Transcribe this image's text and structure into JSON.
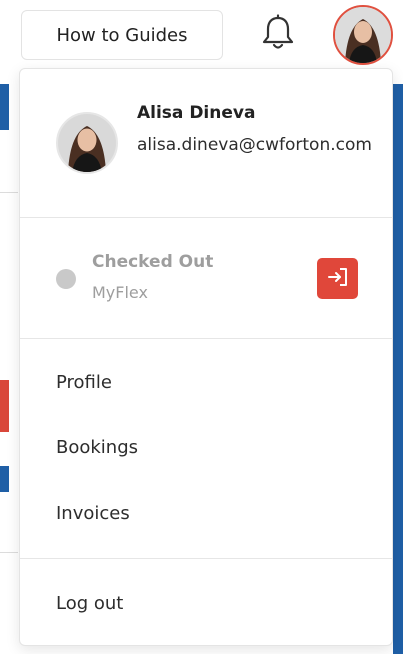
{
  "header": {
    "guides_label": "How to Guides",
    "bell_icon": "bell-icon",
    "avatar_icon": "user-avatar"
  },
  "user": {
    "name": "Alisa Dineva",
    "email": "alisa.dineva@cwforton.com"
  },
  "status": {
    "title": "Checked Out",
    "subtitle": "MyFlex",
    "dot_color": "#c9c9c9",
    "action_icon": "check-in-icon",
    "action_color": "#e0473a"
  },
  "menu": {
    "items": [
      {
        "label": "Profile"
      },
      {
        "label": "Bookings"
      },
      {
        "label": "Invoices"
      }
    ],
    "logout": "Log out"
  },
  "colors": {
    "accent": "#e0503f",
    "brand_blue": "#1f5fa6"
  }
}
